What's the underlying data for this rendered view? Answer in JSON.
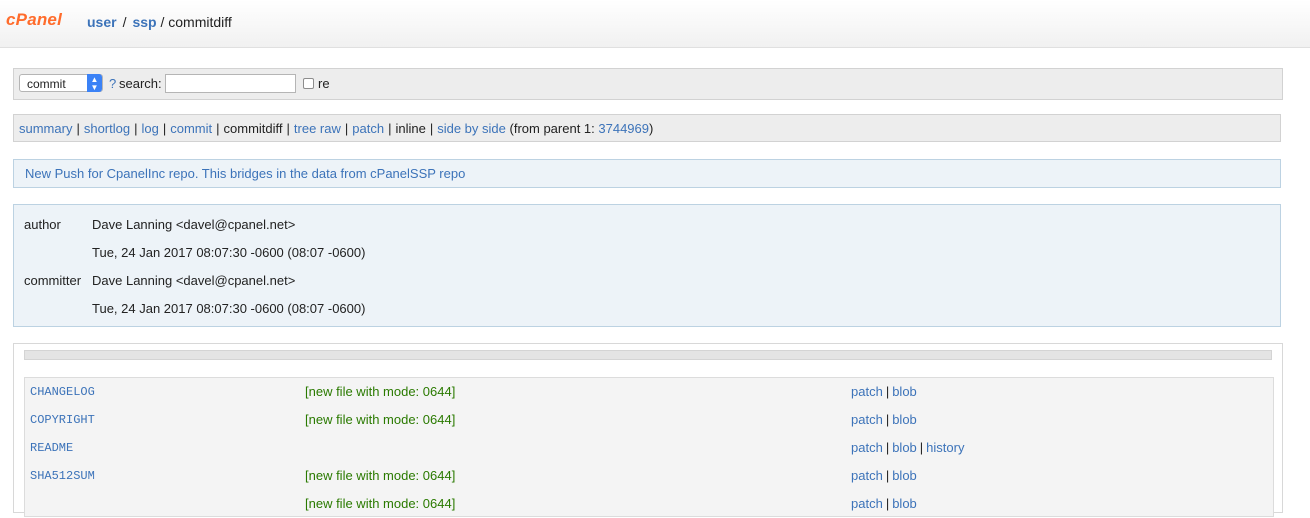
{
  "header": {
    "logo": "cPanel",
    "breadcrumb": {
      "user": "user",
      "repo": "ssp",
      "current": "/ commitdiff",
      "sep": "/"
    }
  },
  "search": {
    "select_value": "commit",
    "help": "?",
    "label": "search:",
    "input_value": "",
    "regex_label": "re"
  },
  "nav": {
    "summary": "summary",
    "shortlog": "shortlog",
    "log": "log",
    "commit": "commit",
    "commitdiff": "commitdiff",
    "tree_raw": "tree raw",
    "patch": "patch",
    "inline": "inline",
    "side_by_side": "side by side",
    "from_parent_prefix": "(from parent 1: ",
    "parent_hash": "3744969",
    "from_parent_suffix": ")",
    "sep": "|"
  },
  "commit": {
    "title": "New Push for CpanelInc repo. This bridges in the data from cPanelSSP repo",
    "author_label": "author",
    "author": "Dave Lanning <davel@cpanel.net>",
    "author_date": "Tue, 24 Jan 2017 08:07:30 -0600 (08:07 -0600)",
    "committer_label": "committer",
    "committer": "Dave Lanning <davel@cpanel.net>",
    "committer_date": "Tue, 24 Jan 2017 08:07:30 -0600 (08:07 -0600)"
  },
  "files": [
    {
      "name": "CHANGELOG",
      "status": "[new file with mode: 0644]",
      "links": [
        "patch",
        "blob"
      ]
    },
    {
      "name": "COPYRIGHT",
      "status": "[new file with mode: 0644]",
      "links": [
        "patch",
        "blob"
      ]
    },
    {
      "name": "README",
      "status": "",
      "links": [
        "patch",
        "blob",
        "history"
      ]
    },
    {
      "name": "SHA512SUM",
      "status": "[new file with mode: 0644]",
      "links": [
        "patch",
        "blob"
      ]
    },
    {
      "name": "",
      "status": "[new file with mode: 0644]",
      "links": [
        "patch",
        "blob"
      ]
    }
  ],
  "colors": {
    "link": "#3c73b9",
    "logo": "#ff6c2c",
    "status_green": "#2a7a00",
    "box_bg": "#edf3f8"
  }
}
